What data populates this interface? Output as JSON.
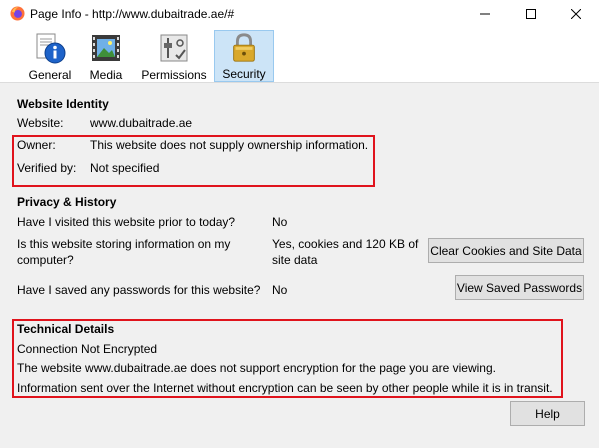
{
  "window": {
    "title": "Page Info - http://www.dubaitrade.ae/#"
  },
  "tabs": [
    {
      "label": "General",
      "icon": "info-icon"
    },
    {
      "label": "Media",
      "icon": "media-icon"
    },
    {
      "label": "Permissions",
      "icon": "permissions-icon"
    },
    {
      "label": "Security",
      "icon": "lock-icon",
      "selected": true
    }
  ],
  "identity": {
    "heading": "Website Identity",
    "website_label": "Website:",
    "website_value": "www.dubaitrade.ae",
    "owner_label": "Owner:",
    "owner_value": "This website does not supply ownership information.",
    "verified_label": "Verified by:",
    "verified_value": "Not specified"
  },
  "privacy": {
    "heading": "Privacy & History",
    "q_visited": "Have I visited this website prior to today?",
    "a_visited": "No",
    "q_storing_line1": "Is this website storing information on my",
    "q_storing_line2": "computer?",
    "a_storing_line1": "Yes, cookies and 120 KB of",
    "a_storing_line2": "site data",
    "clear_button": "Clear Cookies and Site Data",
    "q_passwords": "Have I saved any passwords for this website?",
    "a_passwords": "No",
    "view_passwords_button": "View Saved Passwords"
  },
  "technical": {
    "heading": "Technical Details",
    "status": "Connection Not Encrypted",
    "line1": "The website www.dubaitrade.ae does not support encryption for the page you are viewing.",
    "line2": "Information sent over the Internet without encryption can be seen by other people while it is in transit."
  },
  "help_button": "Help",
  "colors": {
    "highlight_box": "#e0131c",
    "selected_tab": "#cce4f7"
  }
}
